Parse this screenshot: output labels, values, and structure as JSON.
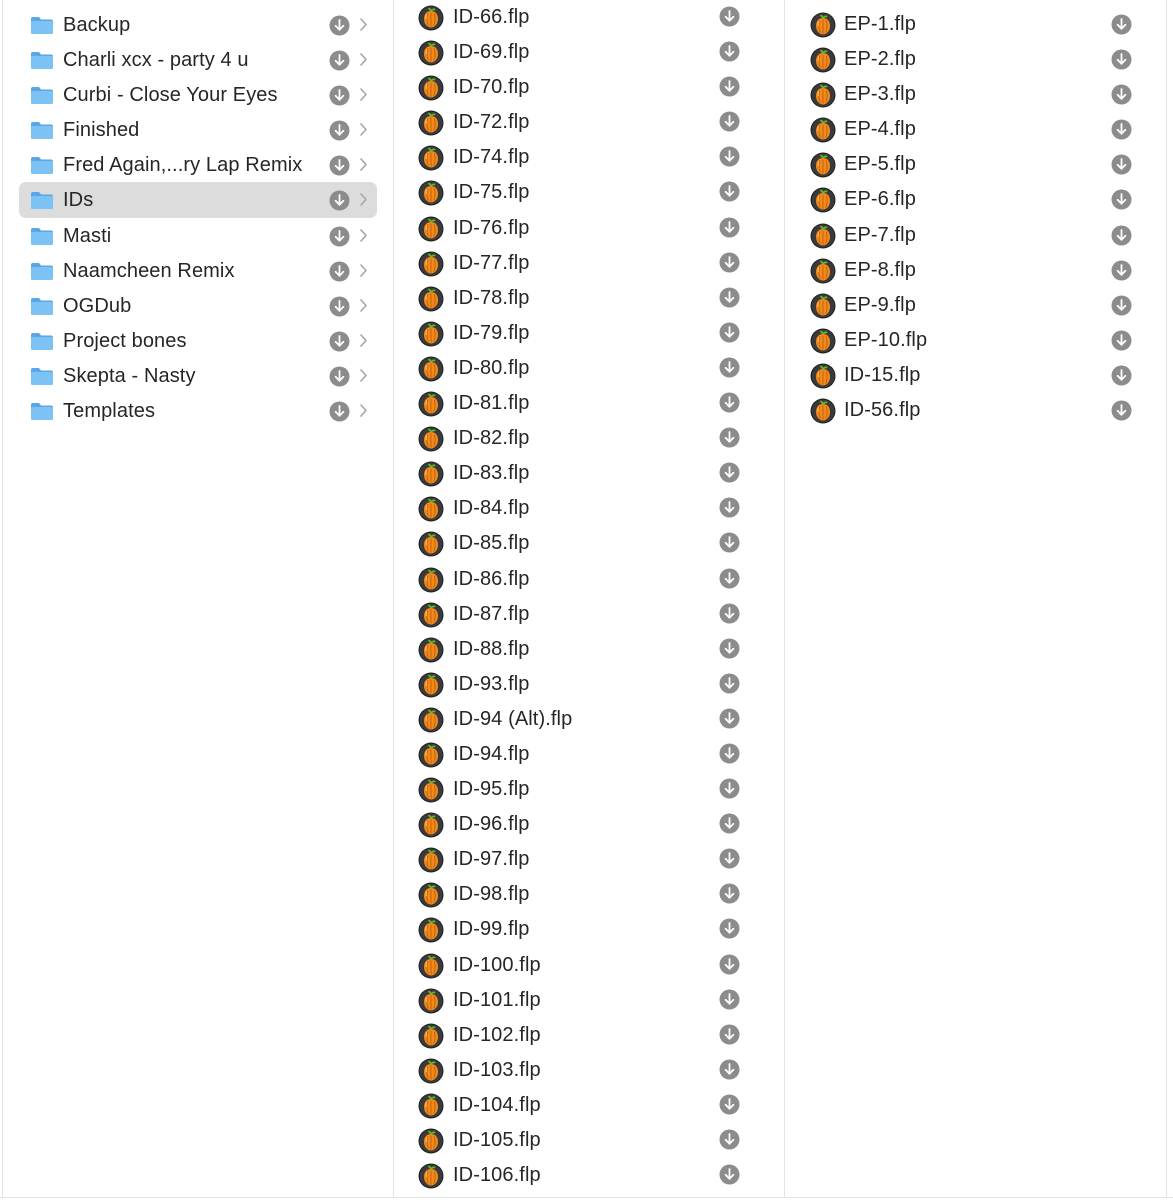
{
  "colors": {
    "selection": "#dcdcdc",
    "folder": "#6cb6f0",
    "download_badge": "#8c8c8c",
    "text": "#262626"
  },
  "icons": {
    "folder": "folder-icon",
    "file": "fl-studio-file-icon",
    "download": "download-circle-icon",
    "chevron": "chevron-right-icon"
  },
  "columns": {
    "folders": {
      "selected_index": 5,
      "items": [
        {
          "label": "Backup"
        },
        {
          "label": "Charli xcx - party 4 u"
        },
        {
          "label": "Curbi - Close Your Eyes"
        },
        {
          "label": "Finished"
        },
        {
          "label": "Fred Again,...ry Lap Remix"
        },
        {
          "label": "IDs"
        },
        {
          "label": "Masti"
        },
        {
          "label": "Naamcheen Remix"
        },
        {
          "label": "OGDub"
        },
        {
          "label": "Project bones"
        },
        {
          "label": "Skepta - Nasty"
        },
        {
          "label": "Templates"
        }
      ]
    },
    "ids": {
      "items": [
        {
          "label": "ID-66.flp"
        },
        {
          "label": "ID-69.flp"
        },
        {
          "label": "ID-70.flp"
        },
        {
          "label": "ID-72.flp"
        },
        {
          "label": "ID-74.flp"
        },
        {
          "label": "ID-75.flp"
        },
        {
          "label": "ID-76.flp"
        },
        {
          "label": "ID-77.flp"
        },
        {
          "label": "ID-78.flp"
        },
        {
          "label": "ID-79.flp"
        },
        {
          "label": "ID-80.flp"
        },
        {
          "label": "ID-81.flp"
        },
        {
          "label": "ID-82.flp"
        },
        {
          "label": "ID-83.flp"
        },
        {
          "label": "ID-84.flp"
        },
        {
          "label": "ID-85.flp"
        },
        {
          "label": "ID-86.flp"
        },
        {
          "label": "ID-87.flp"
        },
        {
          "label": "ID-88.flp"
        },
        {
          "label": "ID-93.flp"
        },
        {
          "label": "ID-94 (Alt).flp"
        },
        {
          "label": "ID-94.flp"
        },
        {
          "label": "ID-95.flp"
        },
        {
          "label": "ID-96.flp"
        },
        {
          "label": "ID-97.flp"
        },
        {
          "label": "ID-98.flp"
        },
        {
          "label": "ID-99.flp"
        },
        {
          "label": "ID-100.flp"
        },
        {
          "label": "ID-101.flp"
        },
        {
          "label": "ID-102.flp"
        },
        {
          "label": "ID-103.flp"
        },
        {
          "label": "ID-104.flp"
        },
        {
          "label": "ID-105.flp"
        },
        {
          "label": "ID-106.flp"
        }
      ]
    },
    "third": {
      "items": [
        {
          "label": "EP-1.flp"
        },
        {
          "label": "EP-2.flp"
        },
        {
          "label": "EP-3.flp"
        },
        {
          "label": "EP-4.flp"
        },
        {
          "label": "EP-5.flp"
        },
        {
          "label": "EP-6.flp"
        },
        {
          "label": "EP-7.flp"
        },
        {
          "label": "EP-8.flp"
        },
        {
          "label": "EP-9.flp"
        },
        {
          "label": "EP-10.flp"
        },
        {
          "label": "ID-15.flp"
        },
        {
          "label": "ID-56.flp"
        }
      ]
    }
  }
}
